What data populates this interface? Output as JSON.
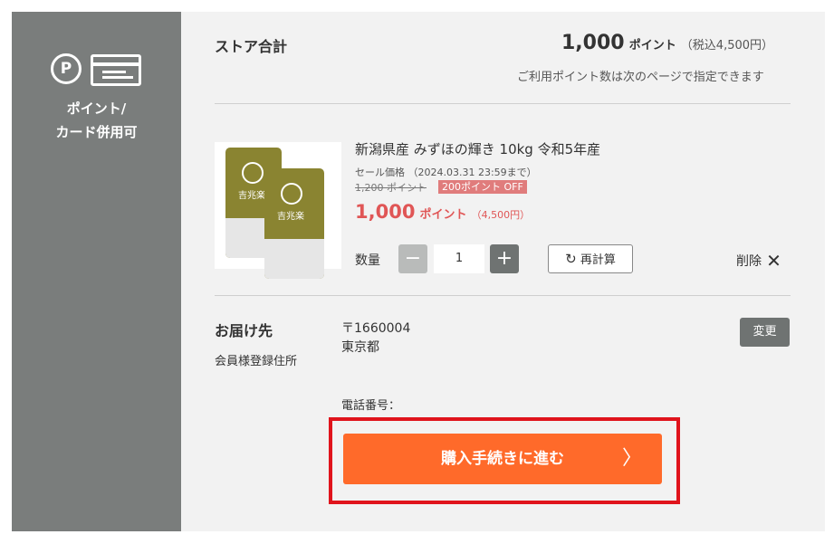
{
  "sidebar": {
    "icons": [
      "point-icon",
      "credit-card-icon"
    ],
    "point_symbol": "P",
    "label_line1": "ポイント/",
    "label_line2": "カード併用可"
  },
  "store_total": {
    "label": "ストア合計",
    "points": "1,000",
    "points_unit": "ポイント",
    "tax_included": "（税込4,500円）",
    "note": "ご利用ポイント数は次のページで指定できます"
  },
  "product": {
    "title": "新潟県産 みずほの輝き 10kg 令和5年産",
    "bag_brand": "吉兆楽",
    "sale_label": "セール価格 （2024.03.31 23:59まで）",
    "original_price": "1,200 ポイント",
    "discount_badge": "200ポイント OFF",
    "price": "1,000",
    "price_unit": "ポイント",
    "price_yen": "（4,500円）",
    "quantity_label": "数量",
    "quantity_value": "1",
    "minus": "−",
    "plus": "+",
    "recalc_label": "再計算",
    "delete_label": "削除"
  },
  "delivery": {
    "label": "お届け先",
    "sub_label": "会員様登録住所",
    "postal": "〒1660004",
    "address": "東京都",
    "phone_label": "電話番号：",
    "change_label": "変更"
  },
  "checkout": {
    "label": "購入手続きに進む",
    "chevron": "〉"
  },
  "colors": {
    "sidebar": "#7a7d7c",
    "panel": "#f2f2f2",
    "accent_price": "#e05656",
    "checkout_button": "#ff6a2a",
    "highlight_border": "#e0141c"
  }
}
